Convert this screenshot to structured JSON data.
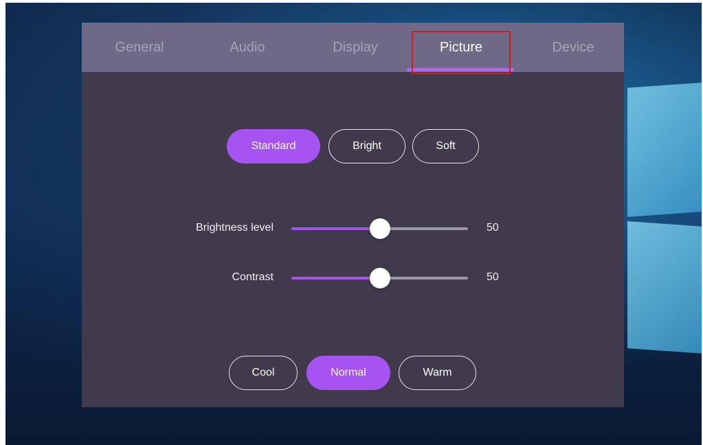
{
  "tabs": [
    {
      "label": "General",
      "active": false
    },
    {
      "label": "Audio",
      "active": false
    },
    {
      "label": "Display",
      "active": false
    },
    {
      "label": "Picture",
      "active": true
    },
    {
      "label": "Device",
      "active": false
    }
  ],
  "picture_modes": {
    "options": [
      "Standard",
      "Bright",
      "Soft"
    ],
    "selected": "Standard"
  },
  "sliders": {
    "brightness": {
      "label": "Brightness level",
      "value": "50",
      "fraction": 0.5
    },
    "contrast": {
      "label": "Contrast",
      "value": "50",
      "fraction": 0.5
    }
  },
  "color_temperature": {
    "options": [
      "Cool",
      "Normal",
      "Warm"
    ],
    "selected": "Normal"
  },
  "colors": {
    "accent": "#a653f2",
    "panel": "#403a4c",
    "tabbar": "#6f6886",
    "highlight_box": "#d7191c"
  }
}
